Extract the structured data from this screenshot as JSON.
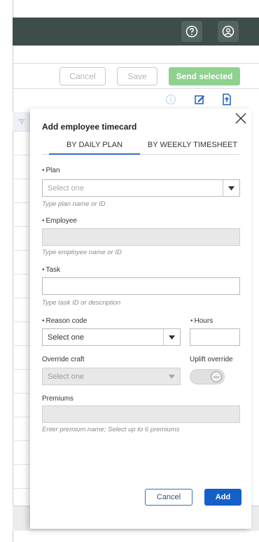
{
  "header": {
    "help_icon": "question-circle-icon",
    "user_icon": "user-circle-icon"
  },
  "toolbar": {
    "cancel_label": "Cancel",
    "save_label": "Save",
    "send_label": "Send selected",
    "icons": [
      "info-icon",
      "edit-icon",
      "export-icon"
    ]
  },
  "panel": {
    "title": "Add employee timecard",
    "tabs": [
      {
        "label": "BY DAILY PLAN",
        "active": true
      },
      {
        "label": "BY WEEKLY TIMESHEET",
        "active": false
      }
    ],
    "plan": {
      "label": "Plan",
      "placeholder": "Select one",
      "hint": "Type plan name or ID"
    },
    "employee": {
      "label": "Employee",
      "value": "",
      "hint": "Type employee name or ID"
    },
    "task": {
      "label": "Task",
      "value": "",
      "hint": "Type task ID or description"
    },
    "reason_code": {
      "label": "Reason code",
      "value": "Select one"
    },
    "hours": {
      "label": "Hours",
      "value": ""
    },
    "override_craft": {
      "label": "Override craft",
      "value": "Select one"
    },
    "uplift_override": {
      "label": "Uplift override",
      "on": false
    },
    "premiums": {
      "label": "Premiums",
      "value": "",
      "hint": "Enter premium name; Select up to 6 premiums"
    },
    "cancel_label": "Cancel",
    "add_label": "Add"
  },
  "colors": {
    "topbar": "#3e4d4a",
    "send_button": "#8fd18f",
    "primary": "#1460c8",
    "tab_underline": "#2f6fc2"
  }
}
